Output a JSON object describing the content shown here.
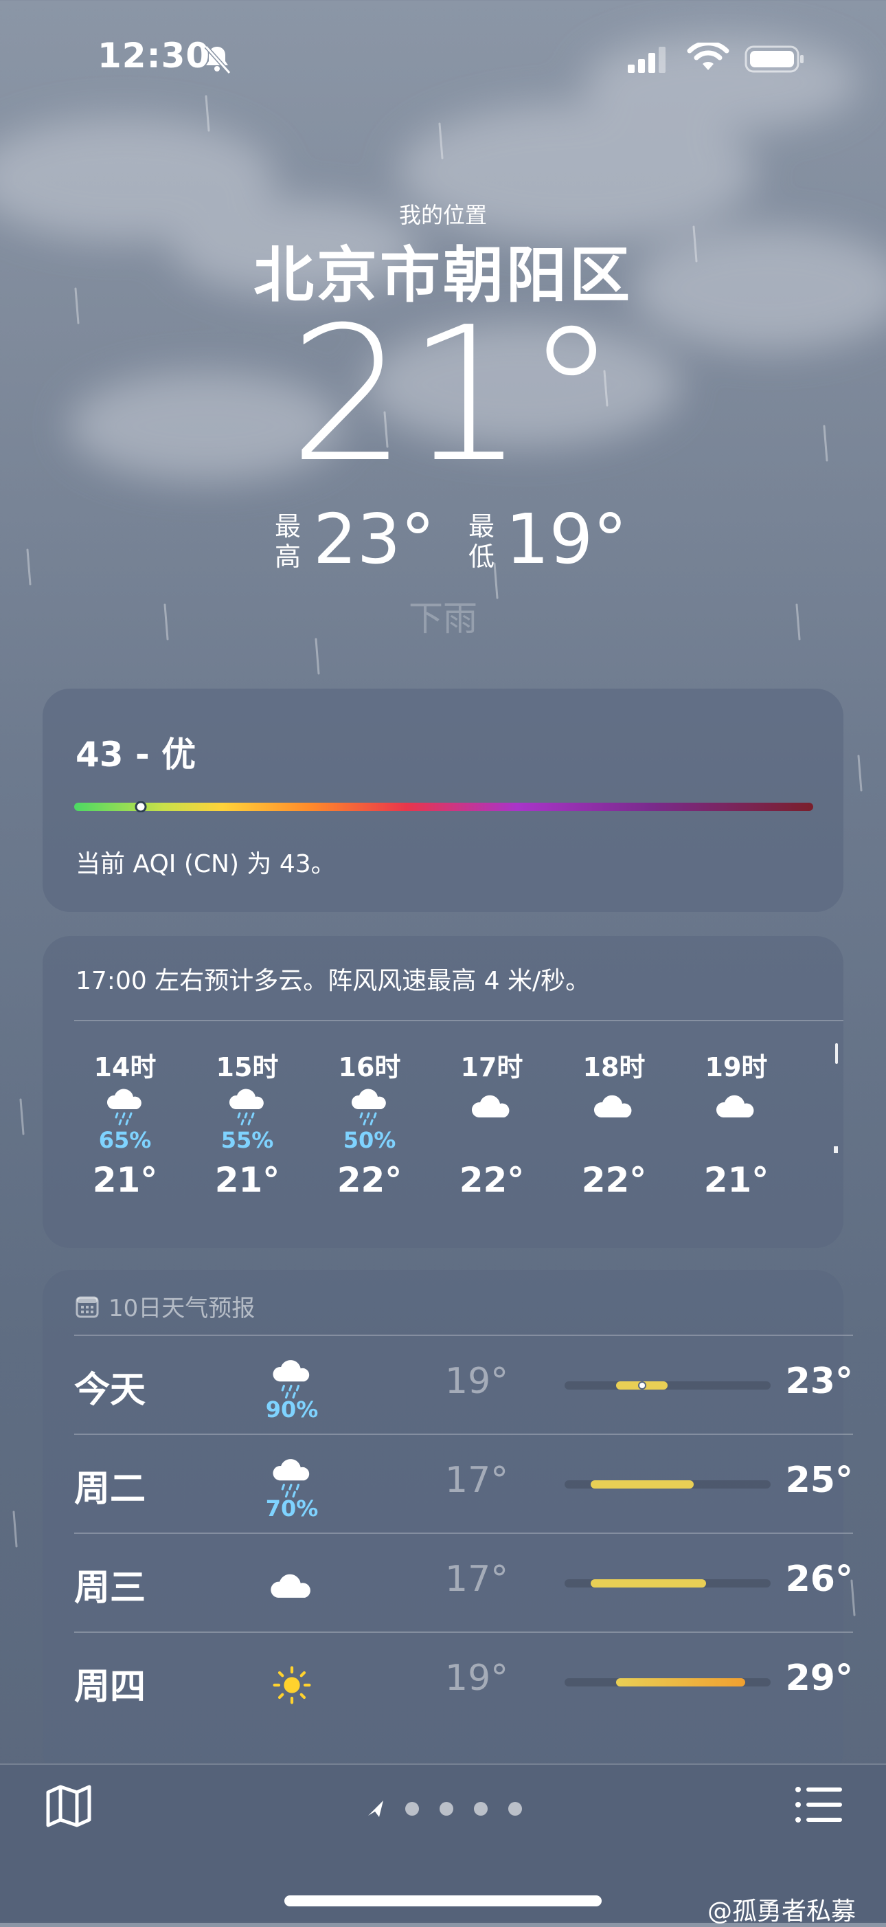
{
  "status_bar": {
    "time": "12:30",
    "silent_icon": "bell-slash-icon",
    "signal_icon": "cellular-signal-icon",
    "wifi_icon": "wifi-icon",
    "battery_icon": "battery-icon"
  },
  "header": {
    "location_label": "我的位置",
    "city": "北京市朝阳区",
    "current_temp": "21°",
    "high_label": "最高",
    "high_temp": "23°",
    "low_label": "最低",
    "low_temp": "19°",
    "condition": "下雨"
  },
  "aqi": {
    "value": "43 - 优",
    "description": "当前 AQI (CN) 为 43。",
    "level_fraction": 0.09
  },
  "hourly": {
    "summary": "17:00 左右预计多云。阵风风速最高 4 米/秒。",
    "hours": [
      {
        "time": "14时",
        "icon": "cloud-rain-icon",
        "pop": "65%",
        "temp": "21°"
      },
      {
        "time": "15时",
        "icon": "cloud-rain-icon",
        "pop": "55%",
        "temp": "21°"
      },
      {
        "time": "16时",
        "icon": "cloud-rain-icon",
        "pop": "50%",
        "temp": "22°"
      },
      {
        "time": "17时",
        "icon": "cloud-icon",
        "pop": "",
        "temp": "22°"
      },
      {
        "time": "18时",
        "icon": "cloud-icon",
        "pop": "",
        "temp": "22°"
      },
      {
        "time": "19时",
        "icon": "cloud-icon",
        "pop": "",
        "temp": "21°"
      }
    ]
  },
  "daily": {
    "title": "10日天气预报",
    "days": [
      {
        "name": "今天",
        "icon": "cloud-rain-icon",
        "pop": "90%",
        "low": "19°",
        "high": "23°"
      },
      {
        "name": "周二",
        "icon": "cloud-rain-icon",
        "pop": "70%",
        "low": "17°",
        "high": "25°"
      },
      {
        "name": "周三",
        "icon": "cloud-icon",
        "pop": "",
        "low": "17°",
        "high": "26°"
      },
      {
        "name": "周四",
        "icon": "sun-icon",
        "pop": "",
        "low": "19°",
        "high": "29°"
      }
    ]
  },
  "toolbar": {
    "map_icon": "map-icon",
    "location_icon": "location-arrow-icon",
    "list_icon": "list-icon"
  },
  "watermark": "@孤勇者私募",
  "colors": {
    "precip_blue": "#7fd3ff",
    "temp_bar_yellow": "#e9cf55",
    "temp_bar_orange": "#f0a030"
  }
}
